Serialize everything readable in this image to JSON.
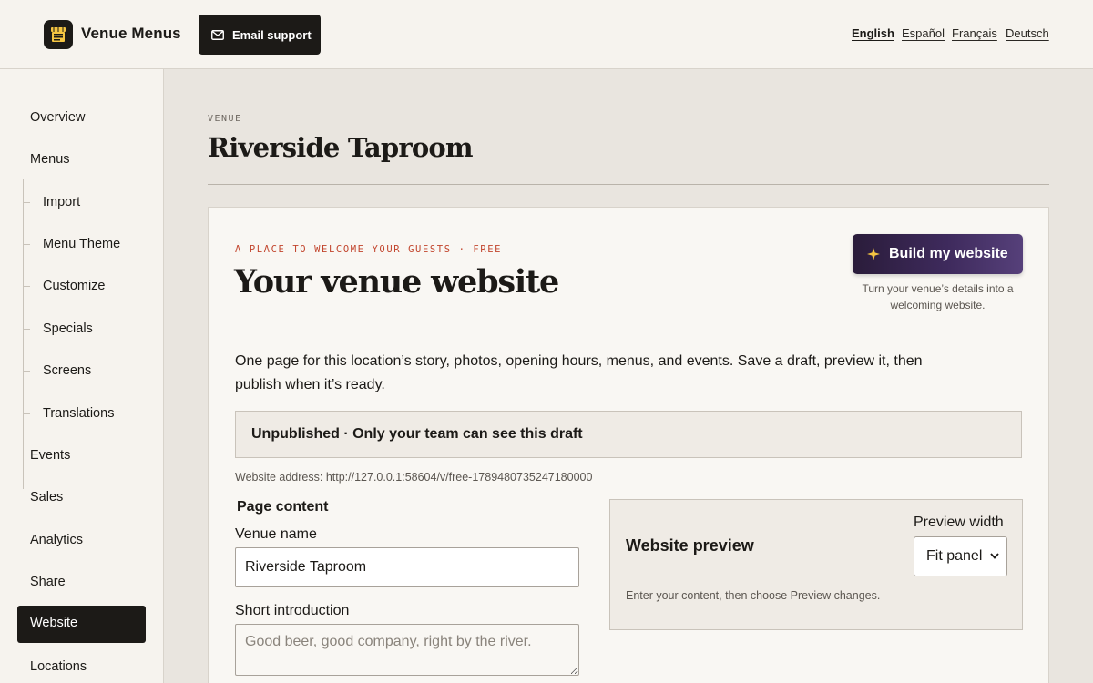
{
  "header": {
    "brand": "Venue Menus",
    "email_support": "Email support",
    "languages": [
      {
        "label": "English",
        "active": true
      },
      {
        "label": "Español",
        "active": false
      },
      {
        "label": "Français",
        "active": false
      },
      {
        "label": "Deutsch",
        "active": false
      }
    ]
  },
  "sidebar": {
    "items": [
      {
        "label": "Overview"
      },
      {
        "label": "Menus"
      },
      {
        "label": "Import"
      },
      {
        "label": "Menu Theme"
      },
      {
        "label": "Customize"
      },
      {
        "label": "Specials"
      },
      {
        "label": "Screens"
      },
      {
        "label": "Translations"
      },
      {
        "label": "Events"
      },
      {
        "label": "Sales"
      },
      {
        "label": "Analytics"
      },
      {
        "label": "Share"
      },
      {
        "label": "Website"
      },
      {
        "label": "Locations"
      }
    ],
    "active_item": "Website"
  },
  "main": {
    "eyebrow": "VENUE",
    "title": "Riverside Taproom"
  },
  "card": {
    "kicker": "A PLACE TO WELCOME YOUR GUESTS · FREE",
    "title": "Your venue website",
    "build_button": "Build my website",
    "build_help": "Turn your venue’s details into a welcoming website.",
    "intro": "One page for this location’s story, photos, opening hours, menus, and events. Save a draft, preview it, then publish when it’s ready.",
    "status": "Unpublished · Only your team can see this draft",
    "address": "Website address: http://127.0.0.1:58604/v/free-1789480735247180000",
    "form": {
      "section": "Page content",
      "venue_name_label": "Venue name",
      "venue_name_value": "Riverside Taproom",
      "intro_label": "Short introduction",
      "intro_placeholder": "Good beer, good company, right by the river."
    },
    "preview": {
      "title": "Website preview",
      "width_label": "Preview width",
      "width_value": "Fit panel",
      "hint": "Enter your content, then choose Preview changes."
    }
  },
  "colors": {
    "accent_dark": "#1c1a17",
    "kicker": "#c2452d",
    "build_button": "#3e2a5c",
    "logo_yellow": "#f5c542"
  }
}
